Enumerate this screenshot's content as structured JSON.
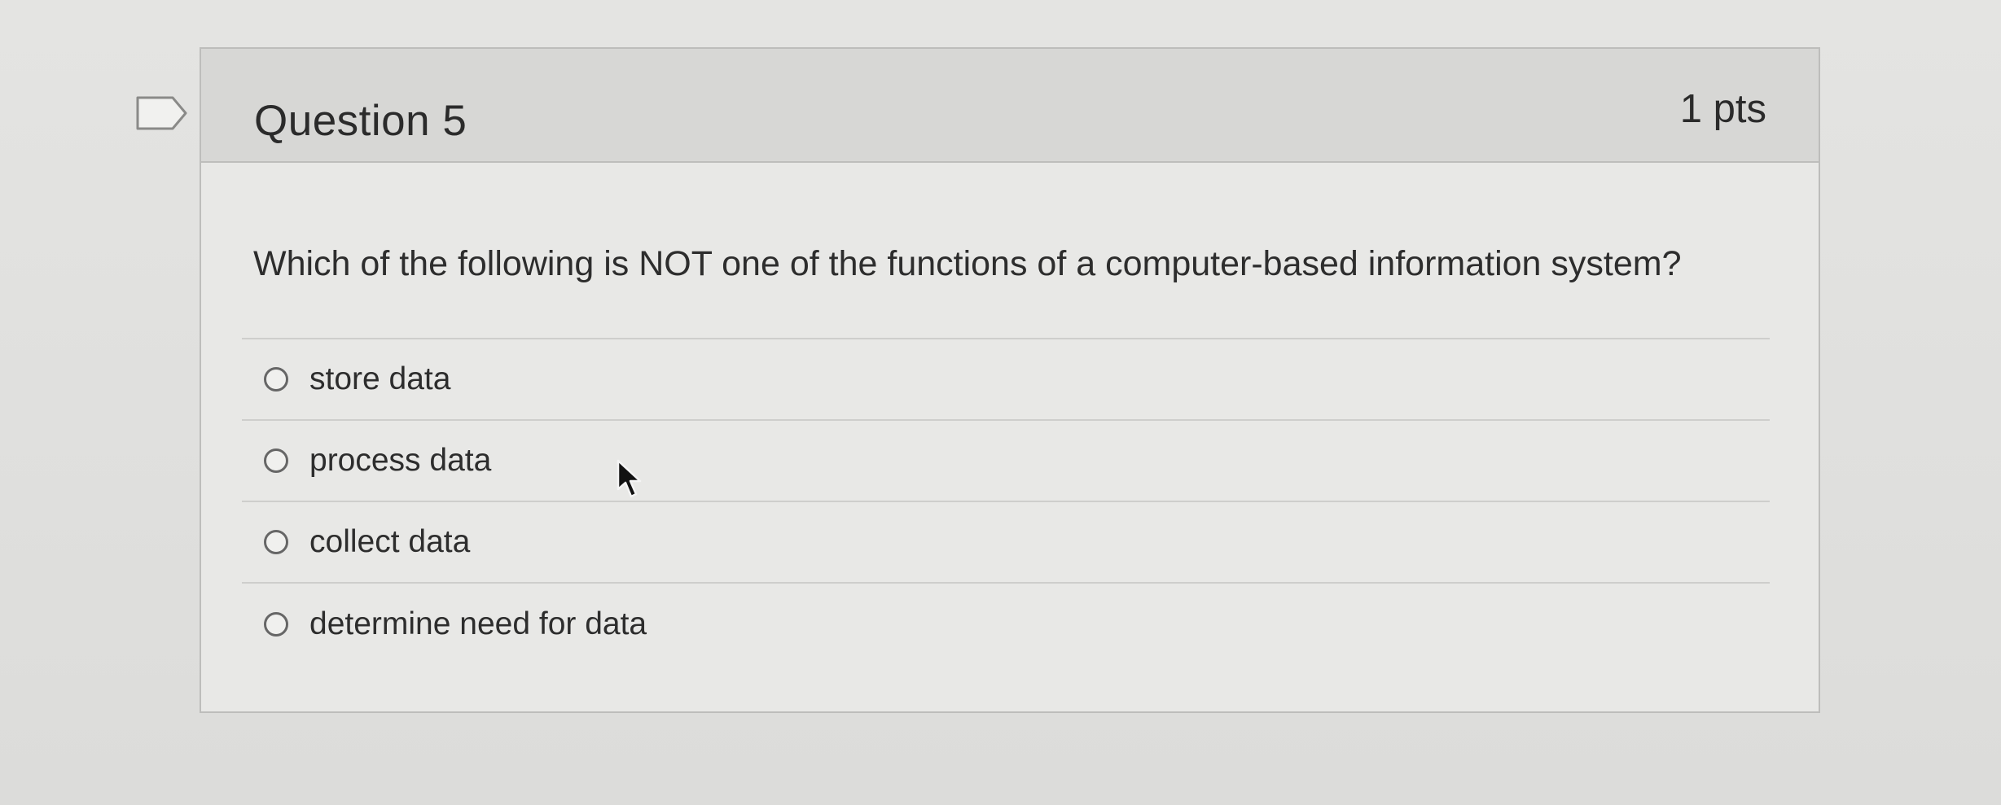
{
  "question": {
    "title": "Question 5",
    "points": "1 pts",
    "text": "Which of the following is NOT one of the functions of a computer-based information system?",
    "answers": [
      {
        "label": "store data",
        "selected": false
      },
      {
        "label": "process data",
        "selected": false
      },
      {
        "label": "collect data",
        "selected": false
      },
      {
        "label": "determine need for data",
        "selected": false
      }
    ]
  },
  "icons": {
    "bookmark": "bookmark-flag-icon",
    "cursor": "mouse-pointer-icon",
    "radio": "radio-unselected-icon"
  },
  "colors": {
    "header_background": "#d7d7d5",
    "card_background": "#e8e8e6",
    "text": "#2d2d2d",
    "border": "#bdbdbb"
  }
}
